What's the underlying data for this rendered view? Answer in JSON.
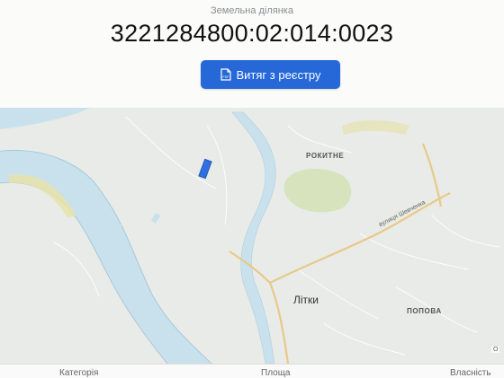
{
  "header": {
    "subtitle": "Земельна ділянка",
    "parcel_number": "3221284800:02:014:0023"
  },
  "extract_button": {
    "label": "Витяг з реєстру",
    "icon": "pdf-file-icon",
    "color": "#2668d8"
  },
  "map": {
    "labels": {
      "rokytne": "РОКИТНЕ",
      "litky": "Літки",
      "popova": "ПОПОВА",
      "street": "вулиця Шевченка"
    },
    "attribution": "О",
    "colors": {
      "water": "#c9e1ec",
      "highlight": "#2f6fe0",
      "forest": "#d6e3bc",
      "road": "#e9c98a"
    }
  },
  "footer": {
    "columns": [
      "Категорія",
      "Площа",
      "Власність"
    ]
  }
}
